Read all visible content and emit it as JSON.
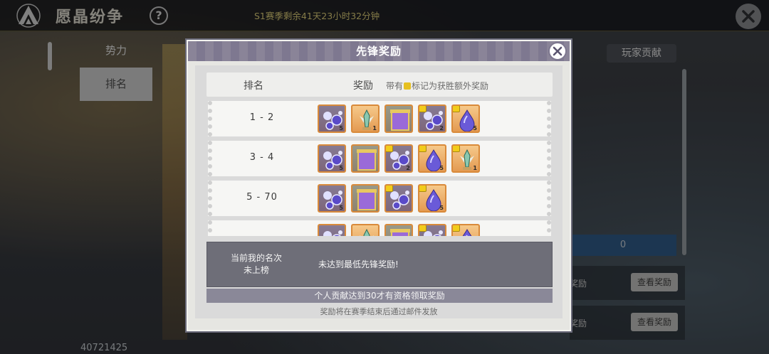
{
  "app": {
    "title": "愿晶纷争",
    "help_label": "?",
    "season_timer": "S1赛季剩余41天23小时32分钟",
    "user_id": "40721425"
  },
  "sidebar": {
    "items": [
      {
        "label": "势力"
      },
      {
        "label": "排名"
      }
    ]
  },
  "right_panel": {
    "tab_label": "玩家贡献",
    "value": "0",
    "reward_rows": [
      {
        "text": "奖励",
        "button": "查看奖励"
      },
      {
        "text": "奖励",
        "button": "查看奖励"
      }
    ]
  },
  "modal": {
    "title": "先锋奖励",
    "table_header": {
      "rank": "排名",
      "reward": "奖励",
      "note_prefix": "带有",
      "note_suffix": "标记为获胜额外奖励"
    },
    "rows": [
      {
        "rank": "1 - 2",
        "rewards": [
          {
            "icon": "crystal-cluster",
            "count": "5",
            "bonus": false
          },
          {
            "icon": "angel-statue",
            "count": "1",
            "bonus": false
          },
          {
            "icon": "purple-banner",
            "count": "",
            "bonus": false
          },
          {
            "icon": "crystal-cluster",
            "count": "2",
            "bonus": true
          },
          {
            "icon": "crystal-drop",
            "count": "5",
            "bonus": true
          }
        ]
      },
      {
        "rank": "3 - 4",
        "rewards": [
          {
            "icon": "crystal-cluster",
            "count": "5",
            "bonus": false
          },
          {
            "icon": "purple-banner",
            "count": "",
            "bonus": false
          },
          {
            "icon": "crystal-cluster",
            "count": "2",
            "bonus": true
          },
          {
            "icon": "crystal-drop",
            "count": "5",
            "bonus": true
          },
          {
            "icon": "angel-statue",
            "count": "1",
            "bonus": true
          }
        ]
      },
      {
        "rank": "5 - 70",
        "rewards": [
          {
            "icon": "crystal-cluster",
            "count": "5",
            "bonus": false
          },
          {
            "icon": "purple-banner",
            "count": "",
            "bonus": false
          },
          {
            "icon": "crystal-cluster",
            "count": "",
            "bonus": true
          },
          {
            "icon": "crystal-drop",
            "count": "5",
            "bonus": true
          }
        ]
      },
      {
        "rank": "",
        "rewards": [
          {
            "icon": "crystal-cluster",
            "count": "",
            "bonus": false
          },
          {
            "icon": "angel-statue",
            "count": "",
            "bonus": false
          },
          {
            "icon": "purple-banner",
            "count": "",
            "bonus": false
          },
          {
            "icon": "crystal-cluster",
            "count": "",
            "bonus": true
          },
          {
            "icon": "crystal-drop",
            "count": "",
            "bonus": true
          }
        ]
      }
    ],
    "my_rank_label_line1": "当前我的名次",
    "my_rank_label_line2": "未上榜",
    "my_rank_message": "未达到最低先锋奖励!",
    "notice": "个人贡献达到30才有资格领取奖励",
    "footer": "奖励将在赛季结束后通过邮件发放"
  },
  "colors": {
    "accent_gold": "#e8d77a",
    "modal_header": "#8a8498",
    "item_bg": "#e39a52",
    "bonus_flag": "#f2cc1a"
  }
}
